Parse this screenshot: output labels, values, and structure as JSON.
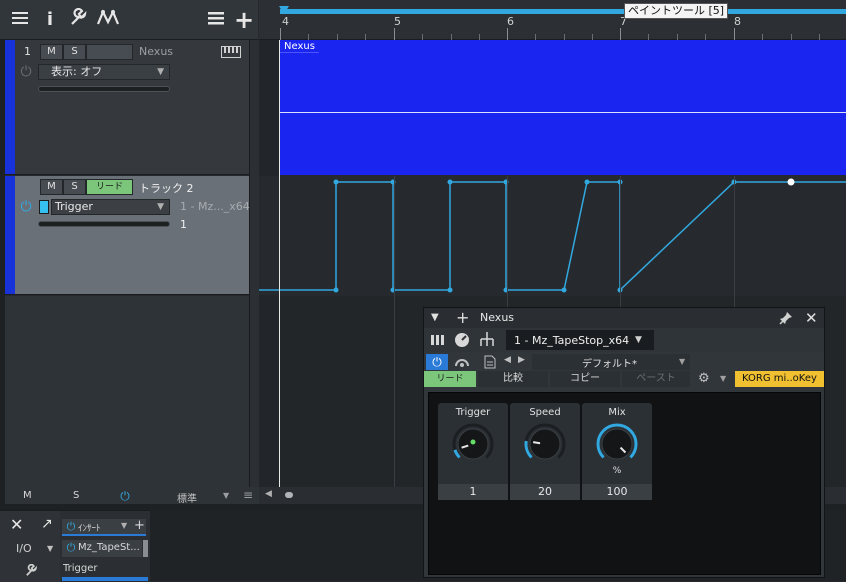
{
  "toolbar": {
    "icons": [
      "list-icon",
      "info-icon",
      "wrench-icon",
      "automation-icon",
      "menu-icon",
      "plus-icon"
    ],
    "info_glyph": "i",
    "plus_glyph": "+"
  },
  "ruler": {
    "bars": [
      "4",
      "5",
      "6",
      "7",
      "8"
    ],
    "tooltip": "ペイントツール [5]"
  },
  "tracks": [
    {
      "number": "1",
      "mute": "M",
      "solo": "S",
      "name": "Nexus",
      "display": "表示: オフ",
      "clip_label": "Nexus"
    },
    {
      "number": "",
      "mute": "M",
      "solo": "S",
      "read": "リード",
      "name": "トラック 2",
      "param": "Trigger",
      "target": "1 - Mz..._x64",
      "value": "1"
    }
  ],
  "bottombar": {
    "m": "M",
    "s": "S",
    "standard": "標準"
  },
  "inspector": {
    "io": "I/O",
    "insert": "ｲﾝｻｰﾄ",
    "insert_item": "Mz_TapeSt...",
    "trigger": "Trigger"
  },
  "plugin": {
    "title": "Nexus",
    "instance": "1 - Mz_TapeStop_x64",
    "preset": "デフォルト*",
    "read": "リード",
    "compare": "比較",
    "copy": "コピー",
    "paste": "ペースト",
    "device": "KORG mi..oKey",
    "knobs": [
      {
        "name": "Trigger",
        "value": "1",
        "unit": "",
        "level": 0.1
      },
      {
        "name": "Speed",
        "value": "20",
        "unit": "",
        "level": 0.2
      },
      {
        "name": "Mix",
        "value": "100",
        "unit": "%",
        "level": 1.0
      }
    ]
  },
  "colors": {
    "accent": "#32a8e0",
    "track_color": "#1632d8",
    "clip": "#1a25f0",
    "read_green": "#7cc67c",
    "device_yellow": "#f0c030"
  }
}
